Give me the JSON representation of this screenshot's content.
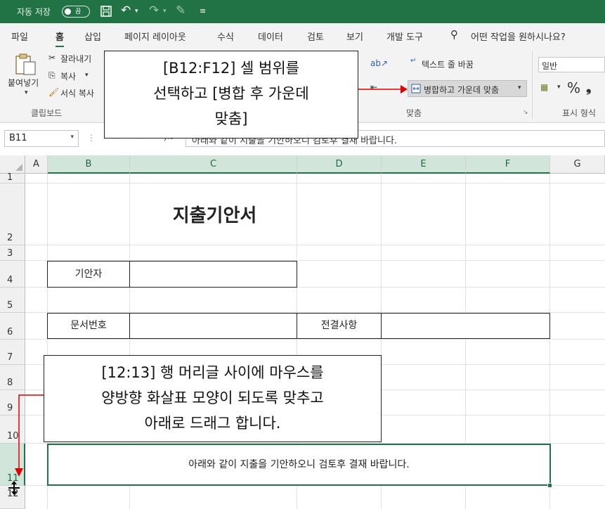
{
  "titlebar": {
    "autosave_label": "자동 저장",
    "autosave_state": "끔",
    "accent_color": "#217346"
  },
  "menu": {
    "items": [
      "파일",
      "홈",
      "삽입",
      "페이지 레이아웃",
      "수식",
      "데이터",
      "검토",
      "보기",
      "개발 도구"
    ],
    "active": "홈",
    "tell_me": "어떤 작업을 원하시나요?"
  },
  "ribbon": {
    "paste_label": "붙여넣기",
    "cut_label": "잘라내기",
    "copy_label": "복사",
    "format_painter_label": "서식 복사",
    "clipboard_group": "클립보드",
    "wrap_text_label": "텍스트 줄 바꿈",
    "merge_center_label": "병합하고 가운데 맞춤",
    "alignment_group": "맞춤",
    "number_format_value": "일반",
    "percent_symbol": "%",
    "number_group": "표시 형식"
  },
  "formula_bar": {
    "name_box": "B11",
    "formula": "아래와 같이 지출을 기안하오니 검토후 결재 바랍니다."
  },
  "columns": [
    "A",
    "B",
    "C",
    "D",
    "E",
    "F",
    "G"
  ],
  "rows": [
    "1",
    "2",
    "3",
    "4",
    "5",
    "6",
    "7",
    "8",
    "9",
    "10",
    "11",
    "12"
  ],
  "sheet": {
    "title": "지출기안서",
    "drafter_label": "기안자",
    "doc_number_label": "문서번호",
    "approval_label": "전결사항",
    "merged_text": "아래와 같이 지출을 기안하오니 검토후 결재 바랍니다."
  },
  "callouts": {
    "top": [
      "[B12:F12] 셀 범위를",
      "선택하고 [병합 후 가운데",
      "맞춤]"
    ],
    "bottom": [
      "[12:13] 행 머리글 사이에 마우스를",
      "양방향 화살표 모양이 되도록 맞추고",
      "아래로 드래그 합니다."
    ]
  },
  "colors": {
    "selection": "#217346",
    "arrow": "#e00000"
  }
}
